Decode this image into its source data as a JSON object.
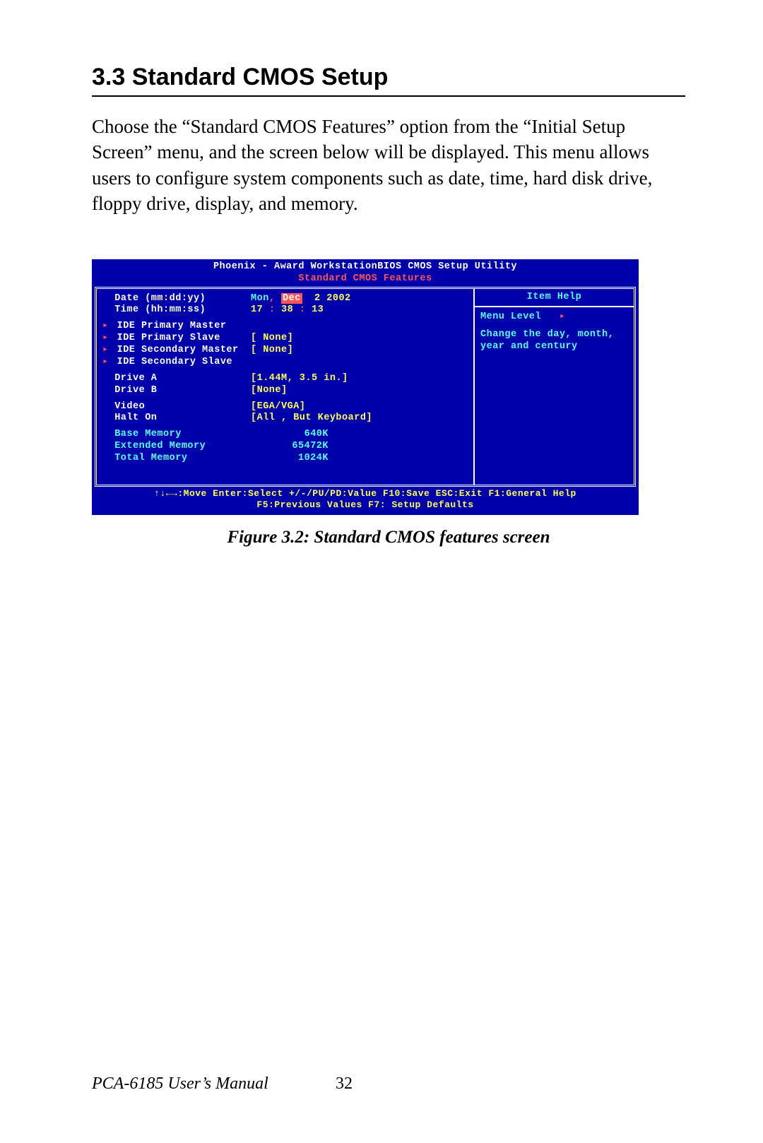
{
  "section": {
    "number": "3.3",
    "title": "Standard CMOS Setup",
    "heading": "3.3  Standard CMOS Setup",
    "paragraph": "Choose the “Standard CMOS Features” option from the “Initial Setup Screen” menu, and the screen below will be displayed. This menu allows users to configure system components such as date, time, hard disk drive, floppy drive, display, and memory."
  },
  "bios": {
    "title_line": "Phoenix - Award WorkstationBIOS CMOS Setup Utility",
    "subtitle_line": "Standard CMOS Features",
    "date_label": "Date (mm:dd:yy)",
    "date_day": "Mon",
    "date_month": "Dec",
    "date_daynum": "2",
    "date_year": "2002",
    "time_label": "Time (hh:mm:ss)",
    "time_hh": "17",
    "time_mm": "38",
    "time_ss": "13",
    "ide": [
      {
        "label": "IDE Primary Master",
        "value": ""
      },
      {
        "label": "IDE Primary Slave",
        "value": "[ None]"
      },
      {
        "label": "IDE Secondary Master",
        "value": "[ None]"
      },
      {
        "label": "IDE Secondary Slave",
        "value": ""
      }
    ],
    "drive_a_label": "Drive A",
    "drive_a_val": "[1.44M, 3.5 in.]",
    "drive_b_label": "Drive B",
    "drive_b_val": "[None]",
    "video_label": "Video",
    "video_val": "[EGA/VGA]",
    "halt_label": "Halt On",
    "halt_val": "[All , But Keyboard]",
    "basemem_label": "Base Memory",
    "basemem_val": "640K",
    "extmem_label": "Extended Memory",
    "extmem_val": "65472K",
    "totmem_label": "Total Memory",
    "totmem_val": "1024K",
    "help_title": "Item Help",
    "menu_level_label": "Menu Level",
    "help_text": "Change the day, month, year and century",
    "legend1": "↑↓←→:Move   Enter:Select   +/-/PU/PD:Value   F10:Save   ESC:Exit   F1:General Help",
    "legend2": "F5:Previous Values              F7: Setup Defaults"
  },
  "figure_caption": "Figure 3.2: Standard CMOS features screen",
  "footer": {
    "manual": "PCA-6185 User’s Manual",
    "page": "32"
  }
}
